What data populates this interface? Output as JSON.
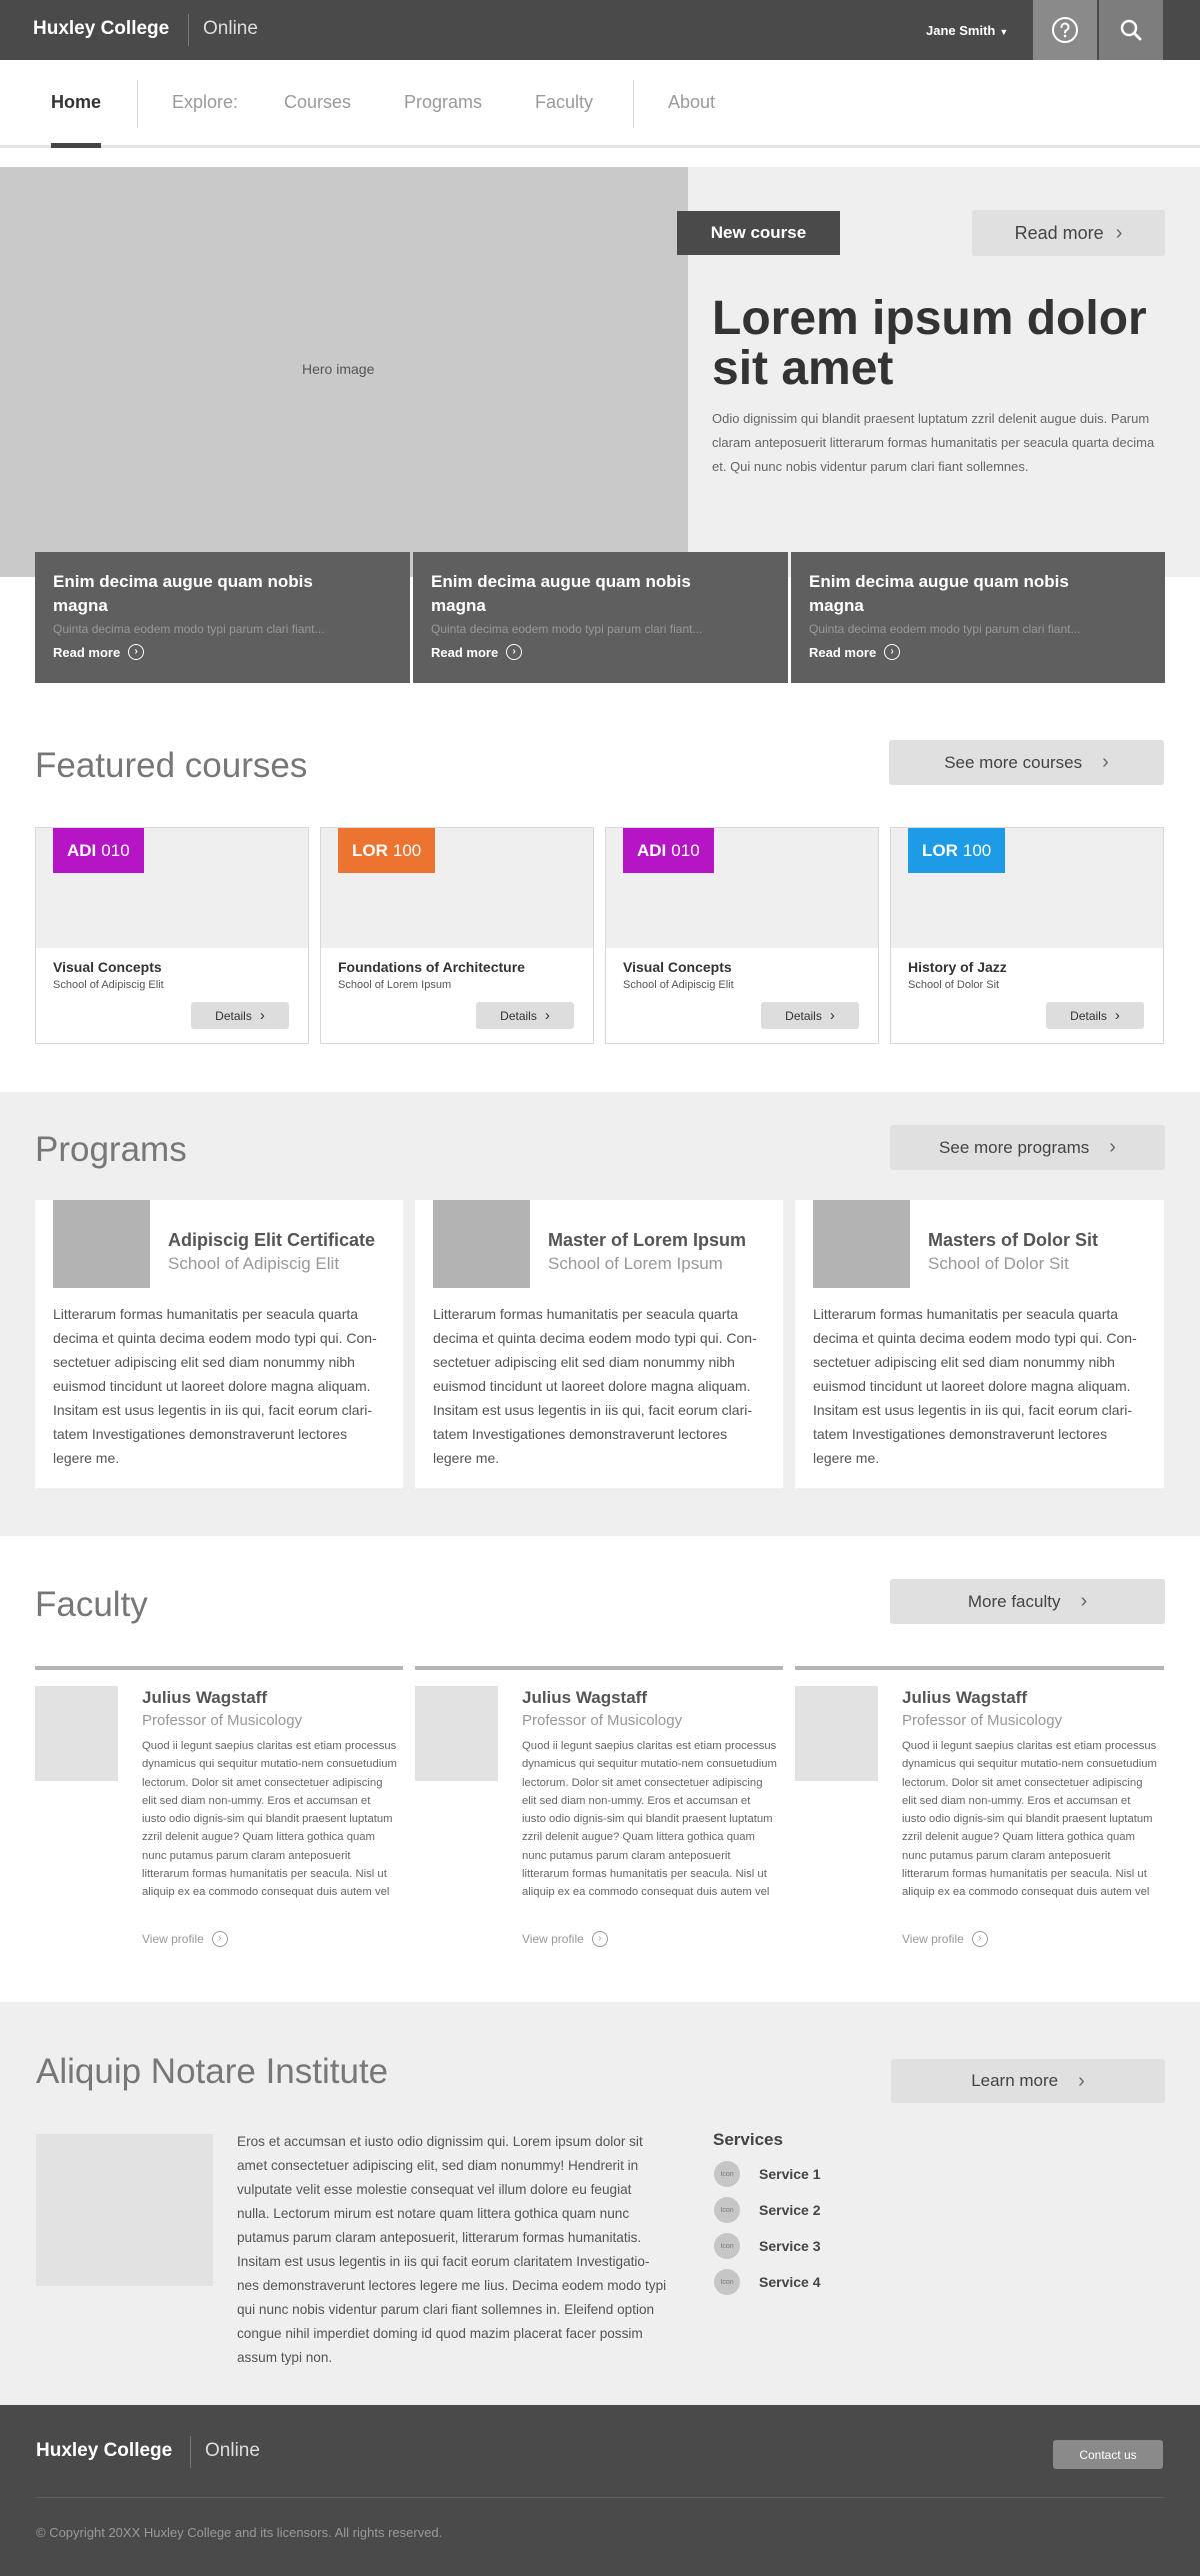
{
  "header": {
    "brand": "Huxley College",
    "brand_sub": "Online",
    "user": "Jane Smith"
  },
  "nav": {
    "home": "Home",
    "explore": "Explore:",
    "courses": "Courses",
    "programs": "Programs",
    "faculty": "Faculty",
    "about": "About"
  },
  "hero": {
    "image_label": "Hero image",
    "badge": "New course",
    "read_more": "Read more",
    "title": "Lorem ipsum dolor sit amet",
    "text": "Odio dignissim qui blandit praesent luptatum zzril delenit augue duis. Parum claram anteposuerit litterarum formas humanitatis per seacula quarta decima et. Qui nunc nobis videntur parum clari fiant sollemnes."
  },
  "teasers": [
    {
      "title": "Enim decima augue quam nobis magna",
      "sub": "Quinta decima eodem modo typi parum clari fiant...",
      "link": "Read more"
    },
    {
      "title": "Enim decima augue quam nobis magna",
      "sub": "Quinta decima eodem modo typi parum clari fiant...",
      "link": "Read more"
    },
    {
      "title": "Enim decima augue quam nobis magna",
      "sub": "Quinta decima eodem modo typi parum clari fiant...",
      "link": "Read more"
    }
  ],
  "featured": {
    "title": "Featured courses",
    "more": "See more courses",
    "courses": [
      {
        "prefix": "ADI",
        "num": "010",
        "color": "#b515c5",
        "name": "Visual Concepts",
        "school": "School of Adipiscig Elit",
        "details": "Details"
      },
      {
        "prefix": "LOR",
        "num": "100",
        "color": "#ec7330",
        "name": "Foundations of Architecture",
        "school": "School of Lorem Ipsum",
        "details": "Details"
      },
      {
        "prefix": "ADI",
        "num": "010",
        "color": "#b515c5",
        "name": "Visual Concepts",
        "school": "School of Adipiscig Elit",
        "details": "Details"
      },
      {
        "prefix": "LOR",
        "num": "100",
        "color": "#1d9be6",
        "name": "History of Jazz",
        "school": "School of Dolor Sit",
        "details": "Details"
      }
    ]
  },
  "programs": {
    "title": "Programs",
    "more": "See more programs",
    "items": [
      {
        "name": "Adipiscig Elit Certificate",
        "school": "School of Adipiscig Elit",
        "text": "Litterarum formas humanitatis per seacula quarta decima et quinta decima eodem modo typi qui. Con-sectetuer adipiscing elit sed diam nonummy nibh euismod tincidunt ut laoreet dolore magna aliquam. Insitam est usus legentis in iis qui, facit eorum clari-tatem Investigationes demonstraverunt lectores legere me."
      },
      {
        "name": "Master of Lorem Ipsum",
        "school": "School of Lorem Ipsum",
        "text": "Litterarum formas humanitatis per seacula quarta decima et quinta decima eodem modo typi qui. Con-sectetuer adipiscing elit sed diam nonummy nibh euismod tincidunt ut laoreet dolore magna aliquam. Insitam est usus legentis in iis qui, facit eorum clari-tatem Investigationes demonstraverunt lectores legere me."
      },
      {
        "name": "Masters of Dolor Sit",
        "school": "School of Dolor Sit",
        "text": "Litterarum formas humanitatis per seacula quarta decima et quinta decima eodem modo typi qui. Con-sectetuer adipiscing elit sed diam nonummy nibh euismod tincidunt ut laoreet dolore magna aliquam. Insitam est usus legentis in iis qui, facit eorum clari-tatem Investigationes demonstraverunt lectores legere me."
      }
    ]
  },
  "faculty": {
    "title": "Faculty",
    "more": "More faculty",
    "items": [
      {
        "name": "Julius Wagstaff",
        "role": "Professor of Musicology",
        "bio": "Quod ii legunt saepius claritas est etiam processus dynamicus qui sequitur mutatio-nem consuetudium lectorum. Dolor sit amet consectetuer adipiscing elit sed diam non-ummy. Eros et accumsan et iusto odio dignis-sim qui blandit praesent luptatum zzril delenit augue? Quam littera gothica quam nunc putamus parum claram anteposuerit litterarum formas humanitatis per seacula. Nisl ut aliquip ex ea commodo consequat duis autem vel",
        "link": "View profile"
      },
      {
        "name": "Julius Wagstaff",
        "role": "Professor of Musicology",
        "bio": "Quod ii legunt saepius claritas est etiam processus dynamicus qui sequitur mutatio-nem consuetudium lectorum. Dolor sit amet consectetuer adipiscing elit sed diam non-ummy. Eros et accumsan et iusto odio dignis-sim qui blandit praesent luptatum zzril delenit augue? Quam littera gothica quam nunc putamus parum claram anteposuerit litterarum formas humanitatis per seacula. Nisl ut aliquip ex ea commodo consequat duis autem vel",
        "link": "View profile"
      },
      {
        "name": "Julius Wagstaff",
        "role": "Professor of Musicology",
        "bio": "Quod ii legunt saepius claritas est etiam processus dynamicus qui sequitur mutatio-nem consuetudium lectorum. Dolor sit amet consectetuer adipiscing elit sed diam non-ummy. Eros et accumsan et iusto odio dignis-sim qui blandit praesent luptatum zzril delenit augue? Quam littera gothica quam nunc putamus parum claram anteposuerit litterarum formas humanitatis per seacula. Nisl ut aliquip ex ea commodo consequat duis autem vel",
        "link": "View profile"
      }
    ]
  },
  "institute": {
    "title": "Aliquip Notare Institute",
    "more": "Learn more",
    "text": "Eros et accumsan et iusto odio dignissim qui. Lorem ipsum dolor sit amet consectetuer adipiscing elit, sed diam nonummy! Hendrerit in vulputate velit esse molestie consequat vel illum dolore eu feugiat nulla. Lectorum mirum est notare quam littera gothica quam nunc putamus parum claram anteposuerit, litterarum formas humanitatis. Insitam est usus legentis in iis qui facit eorum claritatem Investigatio-nes demonstraverunt lectores legere me lius. Decima eodem modo typi qui nunc nobis videntur parum clari fiant sollemnes in. Eleifend option congue nihil imperdiet doming id quod mazim placerat facer possim assum typi non.",
    "services_title": "Services",
    "icon_label": "Icon",
    "services": [
      "Service 1",
      "Service 2",
      "Service 3",
      "Service 4"
    ]
  },
  "footer": {
    "brand": "Huxley College",
    "brand_sub": "Online",
    "contact": "Contact us",
    "copyright": "© Copyright 20XX Huxley College and its licensors. All rights reserved."
  }
}
